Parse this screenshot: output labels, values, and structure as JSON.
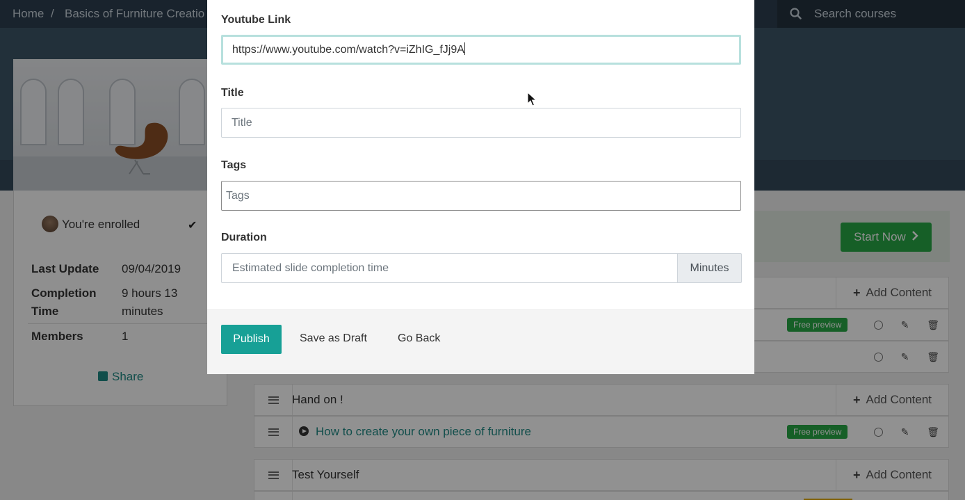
{
  "breadcrumb": {
    "home": "Home",
    "separator": "/",
    "current": "Basics of Furniture Creatio"
  },
  "search": {
    "placeholder": "Search courses"
  },
  "sidebar": {
    "enrolled_text": "You're enrolled",
    "last_update_label": "Last Update",
    "last_update_value": "09/04/2019",
    "completion_label_1": "Completion",
    "completion_label_2": "Time",
    "completion_value_1": "9 hours 13",
    "completion_value_2": "minutes",
    "members_label": "Members",
    "members_value": "1",
    "share_label": "Share"
  },
  "start_button": {
    "label": "Start Now"
  },
  "rows": {
    "add_content_label": "Add Content",
    "free_preview_label": "Free preview",
    "section_hand_on": "Hand on !",
    "lesson_furniture": "How to create your own piece of furniture",
    "section_test": "Test Yourself"
  },
  "modal": {
    "youtube_label": "Youtube Link",
    "youtube_value": "https://www.youtube.com/watch?v=iZhIG_fJj9A",
    "title_label": "Title",
    "title_placeholder": "Title",
    "tags_label": "Tags",
    "tags_placeholder": "Tags",
    "duration_label": "Duration",
    "duration_placeholder": "Estimated slide completion time",
    "duration_unit": "Minutes",
    "publish_label": "Publish",
    "save_draft_label": "Save as Draft",
    "go_back_label": "Go Back"
  },
  "colors": {
    "primary": "#17a096",
    "success": "#28a745",
    "topbar": "#2c3e50"
  },
  "icons": [
    "search-icon",
    "check-icon",
    "share-icon",
    "chevron-right-icon",
    "drag-handle-icon",
    "plus-icon",
    "circle-icon",
    "pencil-icon",
    "trash-icon",
    "play-icon",
    "mouse-cursor-icon"
  ]
}
